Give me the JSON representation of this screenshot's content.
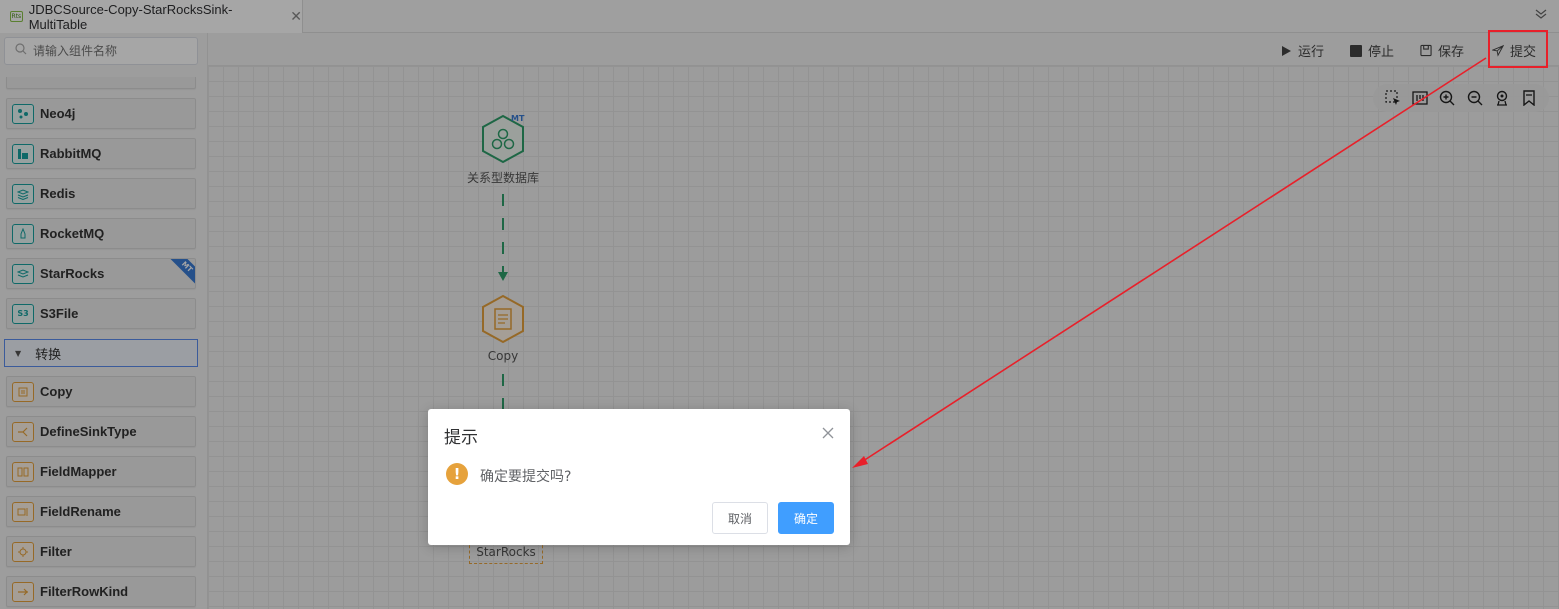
{
  "tab": {
    "icon_text": "Rts",
    "title": "JDBCSource-Copy-StarRocksSink-MultiTable"
  },
  "toolbar": {
    "run": "运行",
    "stop": "停止",
    "save": "保存",
    "submit": "提交"
  },
  "sidebar": {
    "search_placeholder": "请输入组件名称",
    "items": [
      {
        "label": "Neo4j",
        "color": "teal"
      },
      {
        "label": "RabbitMQ",
        "color": "teal"
      },
      {
        "label": "Redis",
        "color": "teal"
      },
      {
        "label": "RocketMQ",
        "color": "teal"
      },
      {
        "label": "StarRocks",
        "color": "teal",
        "badge": "MT"
      },
      {
        "label": "S3File",
        "color": "teal"
      }
    ],
    "group_label": "转换",
    "transform_items": [
      {
        "label": "Copy"
      },
      {
        "label": "DefineSinkType"
      },
      {
        "label": "FieldMapper"
      },
      {
        "label": "FieldRename"
      },
      {
        "label": "Filter"
      },
      {
        "label": "FilterRowKind"
      }
    ]
  },
  "canvas": {
    "nodes": [
      {
        "label": "关系型数据库",
        "badge": "MT"
      },
      {
        "label": "Copy"
      },
      {
        "label": "StarRocks"
      }
    ]
  },
  "dialog": {
    "title": "提示",
    "message": "确定要提交吗?",
    "cancel": "取消",
    "confirm": "确定"
  },
  "colors": {
    "primary": "#409eff",
    "warning": "#e6a23c",
    "annotation": "#e8202a",
    "teal": "#17a2a0"
  }
}
